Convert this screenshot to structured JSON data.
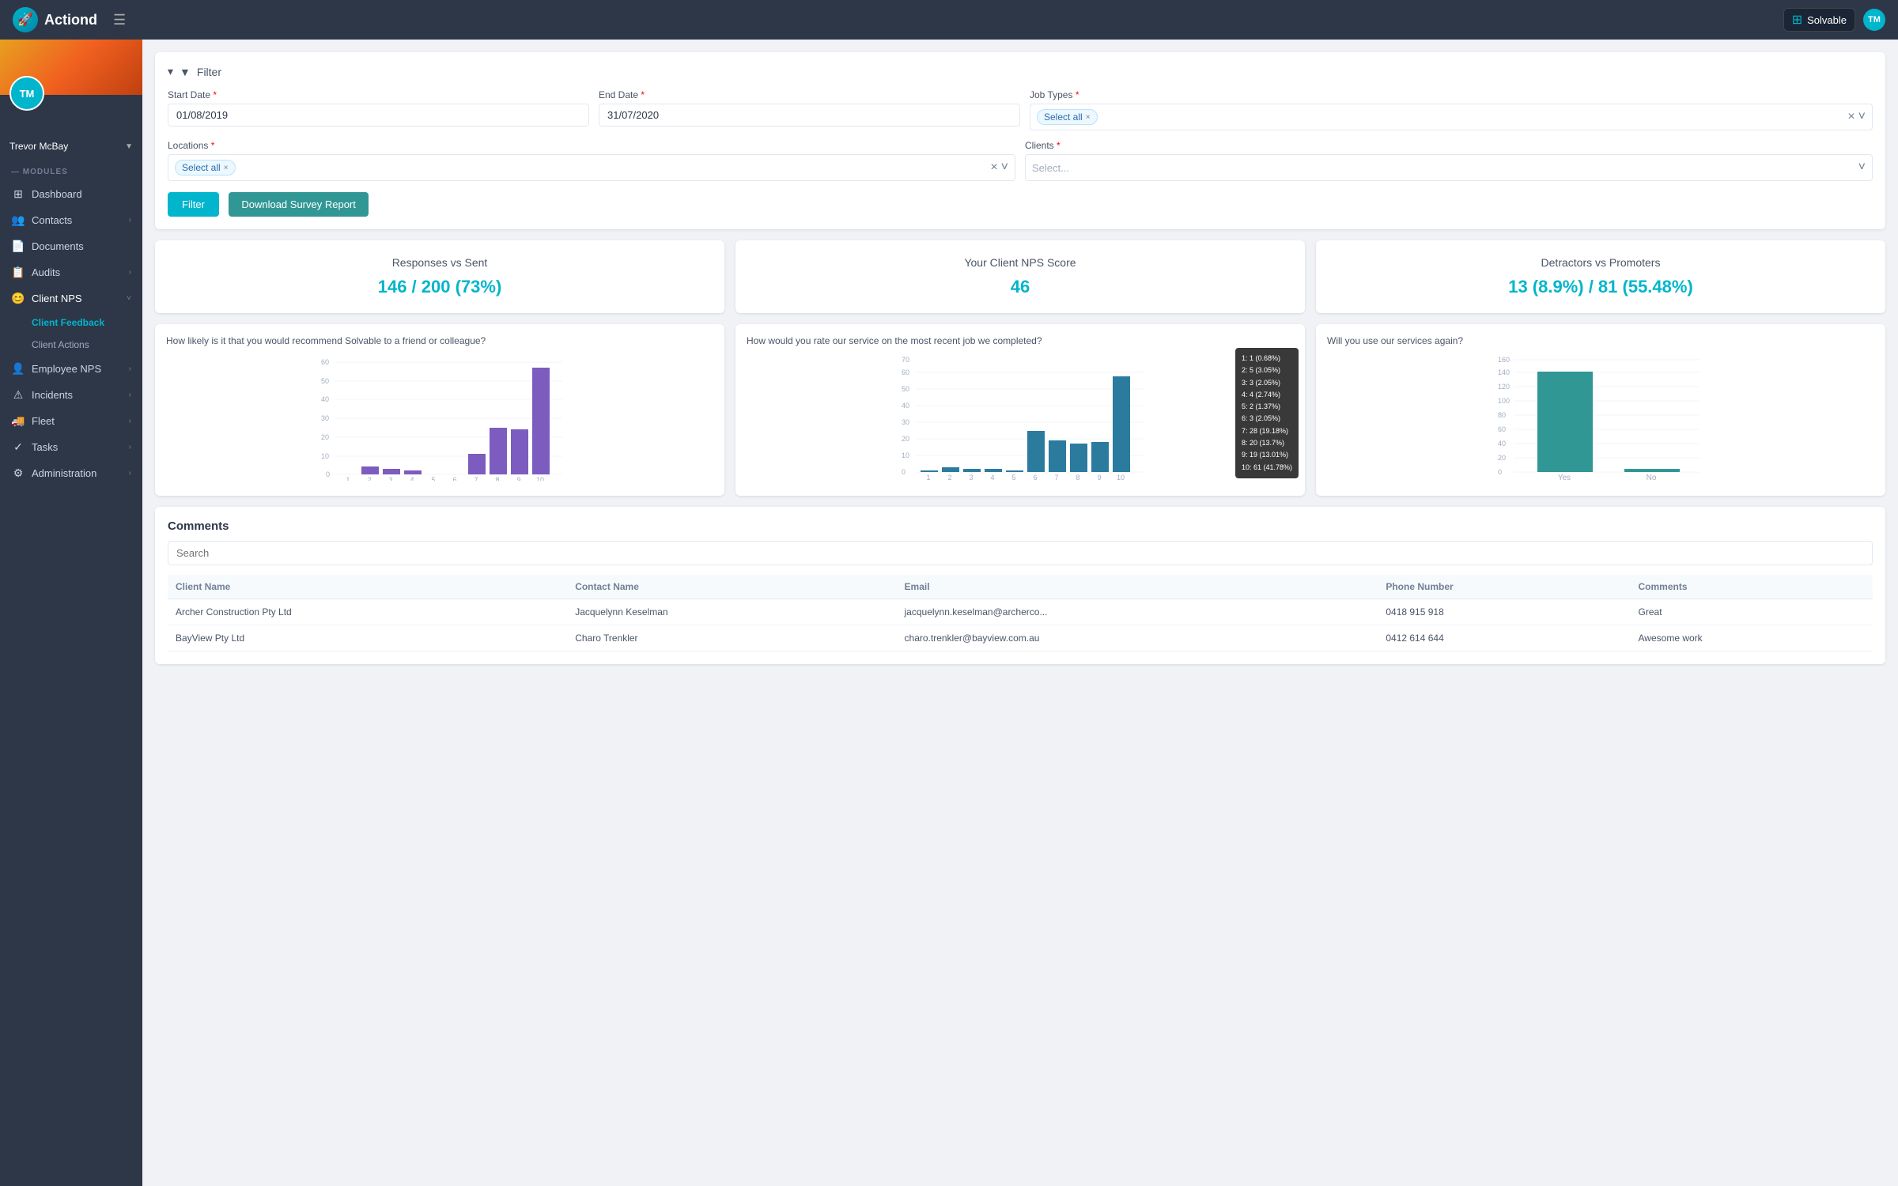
{
  "topbar": {
    "logo_text": "Actiond",
    "logo_icon": "🚀",
    "company": "Solvable",
    "user_initials": "TM"
  },
  "sidebar": {
    "user_name": "Trevor McBay",
    "user_initials": "TM",
    "modules_label": "— MODULES",
    "items": [
      {
        "id": "dashboard",
        "label": "Dashboard",
        "icon": "⊞",
        "has_arrow": false
      },
      {
        "id": "contacts",
        "label": "Contacts",
        "icon": "👥",
        "has_arrow": true
      },
      {
        "id": "documents",
        "label": "Documents",
        "icon": "📄",
        "has_arrow": false
      },
      {
        "id": "audits",
        "label": "Audits",
        "icon": "📋",
        "has_arrow": true
      },
      {
        "id": "client-nps",
        "label": "Client NPS",
        "icon": "😊",
        "has_arrow": true,
        "expanded": true,
        "sub_items": [
          {
            "id": "client-feedback",
            "label": "Client Feedback",
            "active": true
          },
          {
            "id": "client-actions",
            "label": "Client Actions",
            "active": false
          }
        ]
      },
      {
        "id": "employee-nps",
        "label": "Employee NPS",
        "icon": "👤",
        "has_arrow": true
      },
      {
        "id": "incidents",
        "label": "Incidents",
        "icon": "⚠",
        "has_arrow": true
      },
      {
        "id": "fleet",
        "label": "Fleet",
        "icon": "🚚",
        "has_arrow": true
      },
      {
        "id": "tasks",
        "label": "Tasks",
        "icon": "✓",
        "has_arrow": true
      },
      {
        "id": "administration",
        "label": "Administration",
        "icon": "⚙",
        "has_arrow": true
      }
    ]
  },
  "filter": {
    "title": "Filter",
    "start_date_label": "Start Date",
    "start_date_value": "01/08/2019",
    "end_date_label": "End Date",
    "end_date_value": "31/07/2020",
    "job_types_label": "Job Types",
    "job_types_tag": "Select all",
    "locations_label": "Locations",
    "locations_tag": "Select all",
    "clients_label": "Clients",
    "clients_placeholder": "Select...",
    "filter_btn": "Filter",
    "download_btn": "Download Survey Report"
  },
  "stats": [
    {
      "title": "Responses vs Sent",
      "value": "146 / 200 (73%)"
    },
    {
      "title": "Your Client NPS Score",
      "value": "46"
    },
    {
      "title": "Detractors vs Promoters",
      "value": "13 (8.9%) / 81 (55.48%)"
    }
  ],
  "charts": [
    {
      "title": "How likely is it that you would recommend Solvable to a friend or colleague?",
      "type": "bar",
      "color": "#7c5cbf",
      "x_labels": [
        "1",
        "2",
        "3",
        "4",
        "5",
        "6",
        "7",
        "8",
        "9",
        "10"
      ],
      "y_max": 60,
      "y_labels": [
        "0",
        "10",
        "20",
        "30",
        "40",
        "50",
        "60"
      ],
      "values": [
        0,
        4,
        3,
        2,
        0,
        0,
        11,
        25,
        24,
        57
      ]
    },
    {
      "title": "How would you rate our service on the most recent job we completed?",
      "type": "bar",
      "color": "#2b7b9e",
      "x_labels": [
        "1",
        "2",
        "3",
        "4",
        "5",
        "6",
        "7",
        "8",
        "9",
        "10"
      ],
      "y_max": 70,
      "y_labels": [
        "0",
        "10",
        "20",
        "30",
        "40",
        "50",
        "60",
        "70"
      ],
      "values": [
        1,
        3,
        2,
        2,
        1,
        26,
        20,
        18,
        19,
        61
      ],
      "tooltip": {
        "items": [
          "1: 1 (0.68%)",
          "2: 5 (3.05%)",
          "3: 3 (2.05%)",
          "4: 4 (2.74%)",
          "5: 2 (1.37%)",
          "6: 3 (2.05%)",
          "7: 28 (19.18%)",
          "8: 20 (13.7%)",
          "9: 19 (13.01%)",
          "10: 61 (41.78%)"
        ]
      }
    },
    {
      "title": "Will you use our services again?",
      "type": "bar_categorical",
      "color": "#319795",
      "x_labels": [
        "Yes",
        "No"
      ],
      "y_max": 160,
      "y_labels": [
        "0",
        "20",
        "40",
        "60",
        "80",
        "100",
        "120",
        "140",
        "160"
      ],
      "values": [
        143,
        5
      ]
    }
  ],
  "comments": {
    "title": "Comments",
    "search_placeholder": "Search",
    "columns": [
      "Client Name",
      "Contact Name",
      "Email",
      "Phone Number",
      "Comments"
    ],
    "rows": [
      {
        "client_name": "Archer Construction Pty Ltd",
        "contact_name": "Jacquelynn Keselman",
        "email": "jacquelynn.keselman@archerco...",
        "phone": "0418 915 918",
        "comment": "Great"
      },
      {
        "client_name": "BayView Pty Ltd",
        "contact_name": "Charo Trenkler",
        "email": "charo.trenkler@bayview.com.au",
        "phone": "0412 614 644",
        "comment": "Awesome work"
      }
    ]
  }
}
